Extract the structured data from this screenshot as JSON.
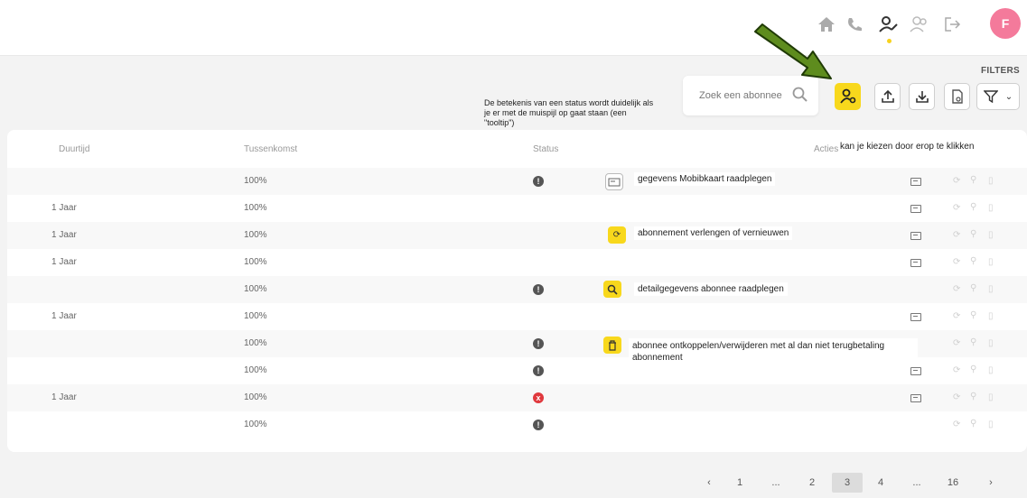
{
  "nav": {
    "icons": [
      "home-icon",
      "phone-icon",
      "user-edit-icon",
      "users-icon",
      "logout-icon"
    ],
    "avatar_letter": "F"
  },
  "toolbar": {
    "filters_label": "FILTERS",
    "search_placeholder": "Zoek een abonnee",
    "buttons": [
      "user-link-icon",
      "upload-icon",
      "download-icon",
      "document-icon",
      "filter-icon"
    ]
  },
  "annotations": {
    "status_tooltip": "De betekenis van een status wordt duidelijk als je er met de muispijl op gaat staan (een \"tooltip\")",
    "acties_note": "kan je kiezen door erop te klikken",
    "tips": [
      "gegevens Mobibkaart raadplegen",
      "abonnement verlengen of vernieuwen",
      "detailgegevens abonnee raadplegen",
      "abonnee ontkoppelen/verwijderen met al dan niet terugbetaling abonnement"
    ]
  },
  "table": {
    "headers": {
      "duurtijd": "Duurtijd",
      "tussenkomst": "Tussenkomst",
      "status": "Status",
      "acties": "Acties"
    },
    "rows": [
      {
        "duurtijd": "",
        "tussenkomst": "100%",
        "status": "!"
      },
      {
        "duurtijd": "1 Jaar",
        "tussenkomst": "100%",
        "status": ""
      },
      {
        "duurtijd": "1 Jaar",
        "tussenkomst": "100%",
        "status": ""
      },
      {
        "duurtijd": "1 Jaar",
        "tussenkomst": "100%",
        "status": ""
      },
      {
        "duurtijd": "",
        "tussenkomst": "100%",
        "status": "!"
      },
      {
        "duurtijd": "1 Jaar",
        "tussenkomst": "100%",
        "status": ""
      },
      {
        "duurtijd": "",
        "tussenkomst": "100%",
        "status": "!"
      },
      {
        "duurtijd": "",
        "tussenkomst": "100%",
        "status": "!"
      },
      {
        "duurtijd": "1 Jaar",
        "tussenkomst": "100%",
        "status": "x"
      },
      {
        "duurtijd": "",
        "tussenkomst": "100%",
        "status": "!"
      }
    ]
  },
  "pagination": {
    "prev": "‹",
    "pages": [
      "1",
      "...",
      "2",
      "3",
      "4",
      "...",
      "16"
    ],
    "active": "3",
    "next": "›"
  },
  "colors": {
    "accent": "#f8d81c",
    "avatar": "#f47a9b",
    "arrow": "#5e8c1e",
    "error": "#e0393e"
  }
}
